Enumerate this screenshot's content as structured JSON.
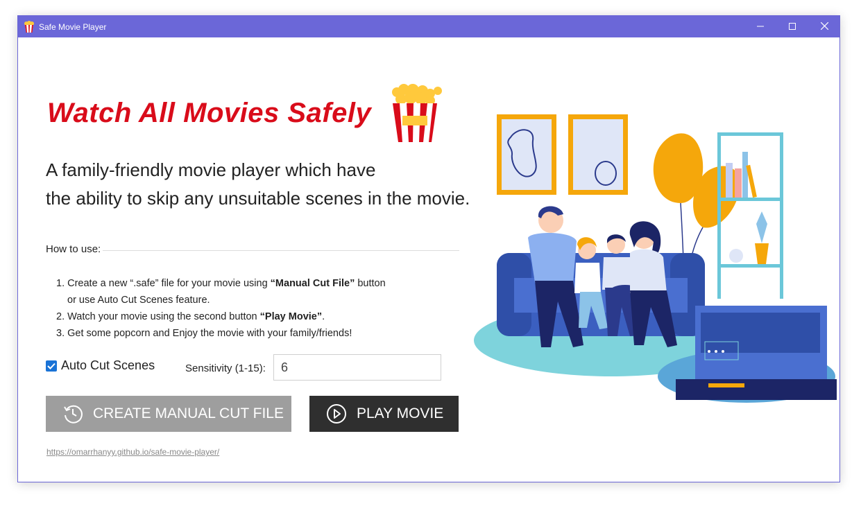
{
  "window": {
    "title": "Safe Movie Player"
  },
  "hero": {
    "headline": "Watch All Movies Safely",
    "subtitle_line1": "A family-friendly movie player which have",
    "subtitle_line2": "the ability to skip any unsuitable scenes in the movie."
  },
  "howto": {
    "label": "How to use:",
    "step1_prefix": "1. Create a new “.safe” file for your movie using ",
    "step1_bold": "“Manual Cut File”",
    "step1_suffix": " button",
    "step1_cont": "or use Auto Cut Scenes feature.",
    "step2_prefix": "2. Watch your movie using the second button ",
    "step2_bold": "“Play Movie”",
    "step2_suffix": ".",
    "step3": "3. Get some popcorn and Enjoy the movie with your family/friends!"
  },
  "settings": {
    "auto_cut_label": "Auto Cut Scenes",
    "auto_cut_checked": true,
    "sensitivity_label": "Sensitivity (1-15):",
    "sensitivity_value": "6"
  },
  "buttons": {
    "manual_cut": "CREATE MANUAL CUT FILE",
    "play_movie": "PLAY MOVIE"
  },
  "footer": {
    "link": "https://omarrhanyy.github.io/safe-movie-player/"
  },
  "colors": {
    "titlebar": "#6b67d8",
    "headline": "#d90c1a",
    "manual_button": "#9e9e9e",
    "play_button": "#2f2f2f",
    "checkbox": "#1a73d6"
  },
  "icons": {
    "app": "popcorn-icon",
    "manual_cut": "history-icon",
    "play": "play-circle-icon"
  }
}
